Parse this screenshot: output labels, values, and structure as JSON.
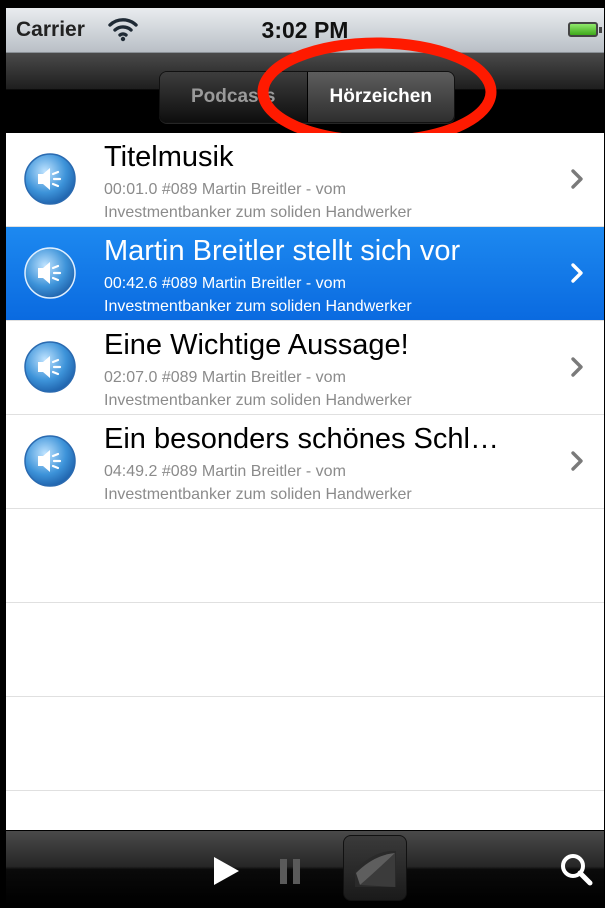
{
  "status_bar": {
    "carrier": "Carrier",
    "time": "3:02 PM"
  },
  "nav": {
    "segments": [
      {
        "label": "Podcasts",
        "selected": false
      },
      {
        "label": "Hörzeichen",
        "selected": true
      }
    ]
  },
  "list": {
    "items": [
      {
        "title": "Titelmusik",
        "line1": "00:01.0 #089 Martin Breitler - vom",
        "line2": "Investmentbanker zum soliden Handwerker",
        "selected": false
      },
      {
        "title": "Martin Breitler stellt sich vor",
        "line1": "00:42.6 #089 Martin Breitler - vom",
        "line2": "Investmentbanker zum soliden Handwerker",
        "selected": true
      },
      {
        "title": "Eine Wichtige Aussage!",
        "line1": "02:07.0 #089 Martin Breitler - vom",
        "line2": "Investmentbanker zum soliden Handwerker",
        "selected": false
      },
      {
        "title": "Ein besonders schönes Schl…",
        "line1": "04:49.2 #089 Martin Breitler - vom",
        "line2": "Investmentbanker zum soliden Handwerker",
        "selected": false
      }
    ]
  },
  "colors": {
    "selection": "#0a6ae0",
    "annotation": "#ff1a00"
  },
  "toolbar": {
    "icons": [
      "play-icon",
      "pause-icon",
      "page-curl-icon",
      "search-icon"
    ]
  }
}
